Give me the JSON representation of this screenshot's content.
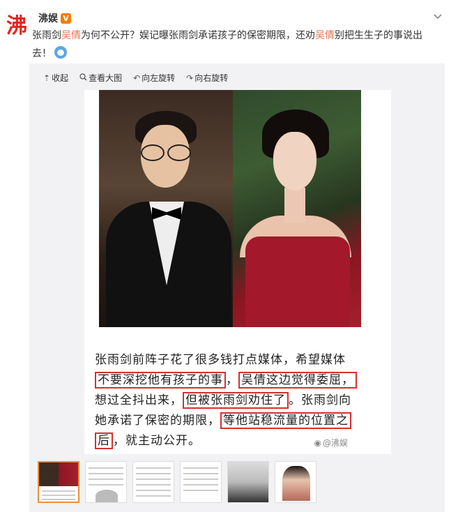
{
  "post": {
    "author": "沸娱",
    "verified_badge": "V",
    "text_parts": [
      {
        "text": "张雨剑",
        "highlight": false
      },
      {
        "text": "吴倩",
        "highlight": true
      },
      {
        "text": "为何不公开？娱记曝张雨剑承诺孩子的保密期限，还劝",
        "highlight": false
      },
      {
        "text": "吴倩",
        "highlight": true
      },
      {
        "text": "别把生生子的事说出去！",
        "highlight": false
      }
    ]
  },
  "toolbar": {
    "collapse": "收起",
    "view_large": "查看大图",
    "rotate_left": "向左旋转",
    "rotate_right": "向右旋转"
  },
  "image_caption": {
    "line1": "张雨剑前阵子花了很多钱打点媒体，希望媒体",
    "box1": "不要深挖他有孩子的事",
    "sep1": "，",
    "box2": "吴倩这边觉得委屈，",
    "line3_start": "想过全抖出来，",
    "box3": "但被张雨剑劝住了",
    "line3_end": "。张雨剑向",
    "line4_start": "她承诺了保密的期限，",
    "box4": "等他站稳流量的位置之",
    "box5": "后",
    "line5_end": "，就主动公开。",
    "watermark": "@沸娱"
  },
  "icons": {
    "avatar": "avatar-logo",
    "verified": "verified-icon",
    "menu": "chevron-down-icon",
    "collapse": "collapse-icon",
    "zoom": "zoom-icon",
    "rotate_left": "rotate-left-icon",
    "rotate_right": "rotate-right-icon",
    "emoji": "emoji-icon"
  },
  "colors": {
    "highlight": "#eb7350",
    "box_border": "#d4302f",
    "active_thumb": "#f28c3b"
  }
}
